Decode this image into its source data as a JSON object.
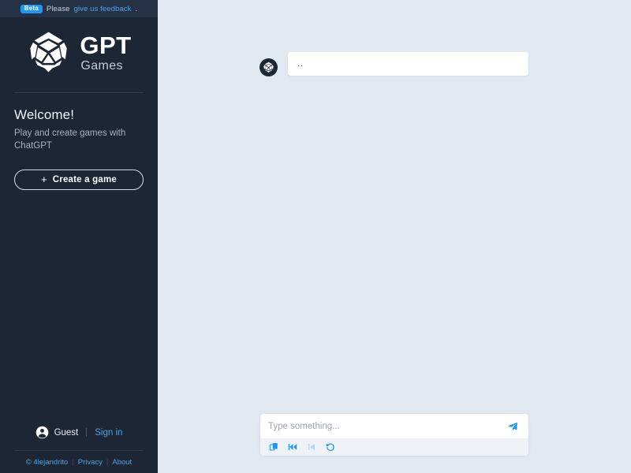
{
  "colors": {
    "sidebar_bg": "#1d2635",
    "banner_bg": "#263347",
    "main_bg": "#e2e8f0",
    "accent_blue": "#2196f3",
    "link_blue": "#4aa3e8",
    "bubble_bg": "#ffffff",
    "toolbar_bg": "#eef2f7"
  },
  "banner": {
    "badge": "Beta",
    "text": "Please",
    "link": "give us feedback",
    "period": "."
  },
  "brand": {
    "logo_icon": "d20-dice-icon",
    "name_primary": "GPT",
    "name_secondary": "Games"
  },
  "welcome": {
    "title": "Welcome!",
    "subtitle": "Play and create games with ChatGPT",
    "create_button": {
      "icon": "plus-icon",
      "label": "Create a game"
    }
  },
  "account": {
    "avatar_icon": "user-circle-icon",
    "name": "Guest",
    "signin_label": "Sign in"
  },
  "footer": {
    "copyright": "© 4lejandrito",
    "sep1": "|",
    "privacy_label": "Privacy",
    "sep2": "|",
    "about_label": "About"
  },
  "chat": {
    "messages": [
      {
        "author_avatar_icon": "d20-dice-avatar-icon",
        "text": ".."
      }
    ]
  },
  "composer": {
    "placeholder": "Type something...",
    "value": "",
    "send_icon": "paper-plane-icon",
    "tools": [
      {
        "icon": "copy-icon",
        "name": "copy-button",
        "disabled": false
      },
      {
        "icon": "fast-backward-icon",
        "name": "restart-button",
        "disabled": false
      },
      {
        "icon": "step-backward-icon",
        "name": "step-back-button",
        "disabled": true
      },
      {
        "icon": "undo-icon",
        "name": "reset-button",
        "disabled": false
      }
    ]
  }
}
